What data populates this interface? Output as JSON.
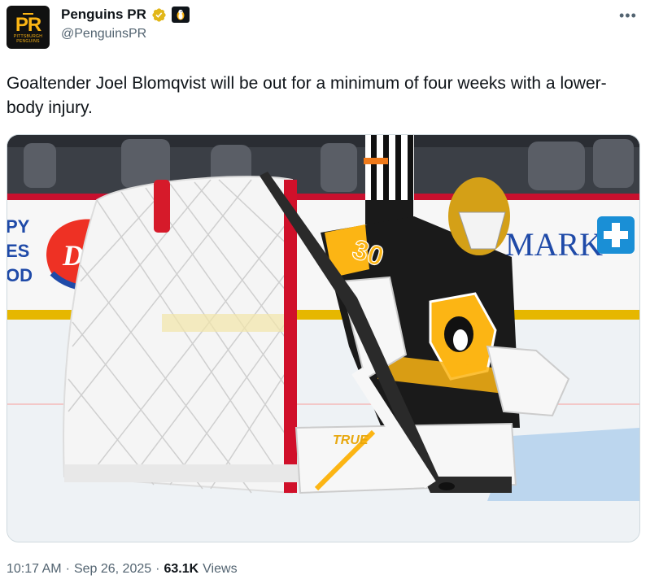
{
  "account": {
    "display_name": "Penguins PR",
    "handle": "@PenguinsPR",
    "avatar_text": "PR",
    "avatar_subtext": "PITTSBURGH PENGUINS",
    "verified_icon": "verified-badge-icon",
    "affiliate_icon": "penguin-logo-icon"
  },
  "menu": {
    "more_label": "•••"
  },
  "tweet": {
    "text": "Goaltender Joel Blomqvist will be out for a minimum of four weeks with a lower-body injury."
  },
  "media": {
    "board_ad_dq": "DQ",
    "board_ad_left": "PY\nES\nOD",
    "board_ad_right": "MARK",
    "jersey_number": "30",
    "pad_brand": "TRUE"
  },
  "meta": {
    "time": "10:17 AM",
    "separator": "·",
    "date": "Sep 26, 2025",
    "views_count": "63.1K",
    "views_label": "Views"
  },
  "colors": {
    "brand_gold": "#fcb514",
    "verified_gold": "#e2b719",
    "text_primary": "#0f1419",
    "text_secondary": "#536471"
  }
}
